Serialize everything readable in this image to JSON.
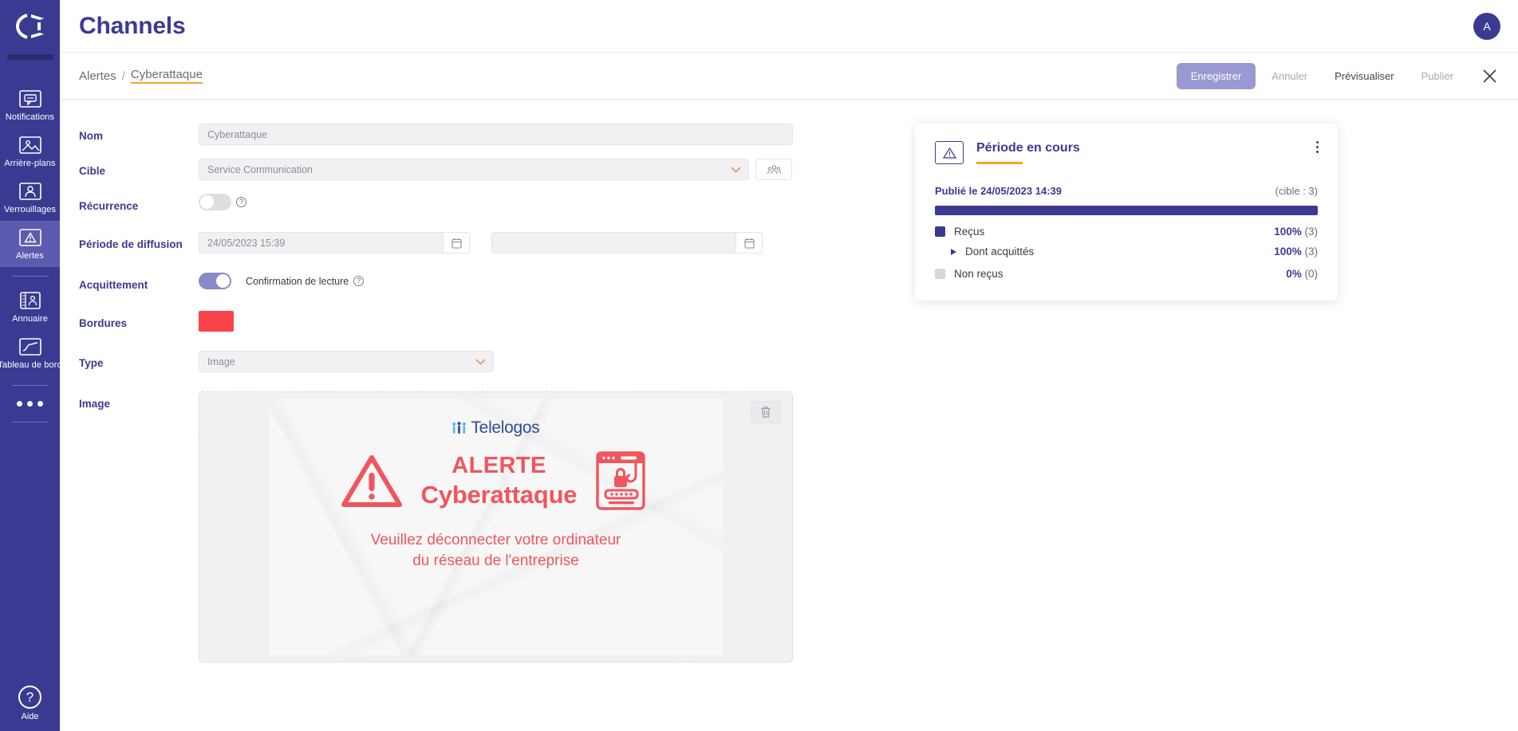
{
  "sidebar": {
    "logo_name": "telelogos-logo",
    "items": [
      {
        "label": "Notifications",
        "icon": "notification-icon",
        "active": false
      },
      {
        "label": "Arrière-plans",
        "icon": "image-icon",
        "active": false
      },
      {
        "label": "Verrouillages",
        "icon": "user-lock-icon",
        "active": false
      },
      {
        "label": "Alertes",
        "icon": "alert-triangle-icon",
        "active": true
      },
      {
        "label": "Annuaire",
        "icon": "address-book-icon",
        "active": false
      },
      {
        "label": "Tableau de bord",
        "icon": "chart-icon",
        "active": false
      }
    ],
    "more_label": "more-menu",
    "help_label": "Aide",
    "help_glyph": "?"
  },
  "header": {
    "title": "Channels",
    "avatar_initial": "A"
  },
  "breadcrumb": {
    "root": "Alertes",
    "separator": "/",
    "current": "Cyberattaque"
  },
  "actions": {
    "save": "Enregistrer",
    "cancel": "Annuler",
    "preview": "Prévisualiser",
    "publish": "Publier",
    "close": "close-icon"
  },
  "form": {
    "name": {
      "label": "Nom",
      "value": "Cyberattaque",
      "placeholder": "Nom"
    },
    "target": {
      "label": "Cible",
      "value": "Service Communication",
      "placeholder": "Cible",
      "picker_icon": "users-group-icon"
    },
    "recurrence": {
      "label": "Récurrence",
      "state": "off",
      "help": "?"
    },
    "period": {
      "label": "Période de diffusion",
      "start_value": "24/05/2023 15:39",
      "end_value": "",
      "end_placeholder": "",
      "calendar_icon": "calendar-icon"
    },
    "acknowledgement": {
      "label": "Acquittement",
      "state": "on",
      "note": "Confirmation de lecture",
      "help": "?"
    },
    "borders": {
      "label": "Bordures",
      "color": "#f9434a"
    },
    "type": {
      "label": "Type",
      "value": "Image",
      "options": [
        "Image"
      ]
    },
    "image": {
      "label": "Image",
      "delete_icon": "trash-icon"
    }
  },
  "poster": {
    "brand": "Telelogos",
    "title_line1": "ALERTE",
    "title_line2": "Cyberattaque",
    "subtitle_line1": "Veuillez déconnecter votre ordinateur",
    "subtitle_line2": "du réseau de l'entreprise",
    "accent_color": "#f0565c"
  },
  "stats_card": {
    "icon": "alert-triangle-icon",
    "title": "Période en cours",
    "menu_icon": "kebab-menu-icon",
    "published_label": "Publié le 24/05/2023 14:39",
    "target_label": "(cible : 3)",
    "progress_percent": 100,
    "rows": [
      {
        "name": "Reçus",
        "percent": "100%",
        "count": "(3)",
        "swatch": "#3b3a93",
        "type": "swatch"
      },
      {
        "name": "Dont acquittés",
        "percent": "100%",
        "count": "(3)",
        "type": "expander"
      },
      {
        "name": "Non reçus",
        "percent": "0%",
        "count": "(0)",
        "swatch": "#d6d6dd",
        "type": "swatch"
      }
    ]
  }
}
